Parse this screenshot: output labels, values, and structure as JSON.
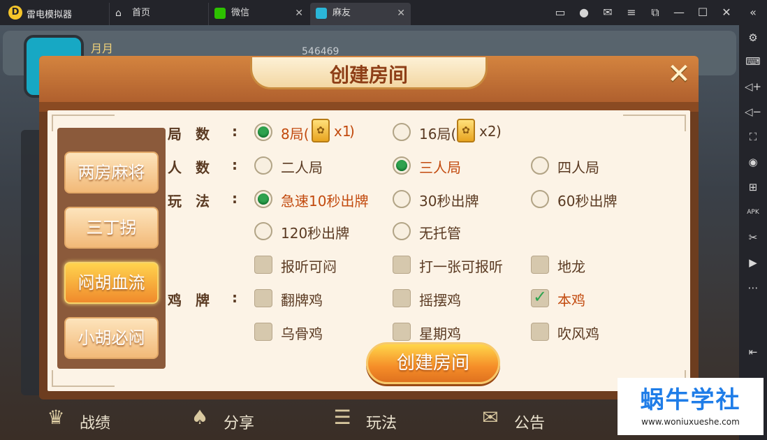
{
  "titlebar": {
    "app_name": "雷电模拟器",
    "tabs": [
      {
        "label": "首页",
        "icon": "home-icon"
      },
      {
        "label": "微信",
        "icon": "wechat-icon"
      },
      {
        "label": "麻友",
        "icon": "mayou-app-icon"
      }
    ]
  },
  "game_bg": {
    "player_name": "月月",
    "coins": "546469",
    "bottom_nav": [
      {
        "label": "战绩",
        "icon": "trophy-icon"
      },
      {
        "label": "分享",
        "icon": "share-icon"
      },
      {
        "label": "玩法",
        "icon": "rules-icon"
      },
      {
        "label": "公告",
        "icon": "mail-icon"
      }
    ]
  },
  "dialog": {
    "title": "创建房间",
    "modes": [
      "两房麻将",
      "三丁拐",
      "闷胡血流",
      "小胡必闷"
    ],
    "selected_mode": "闷胡血流",
    "labels": {
      "rounds": "局数",
      "players": "人数",
      "play": "玩法",
      "chicken": "鸡牌"
    },
    "rounds": [
      {
        "text": "8局(",
        "multiplier": "x1",
        "checked": true
      },
      {
        "text": "16局(",
        "multiplier": "x2",
        "checked": false
      }
    ],
    "players": [
      {
        "text": "二人局",
        "checked": false
      },
      {
        "text": "三人局",
        "checked": true
      },
      {
        "text": "四人局",
        "checked": false
      }
    ],
    "play": [
      {
        "text": "急速10秒出牌",
        "checked": true
      },
      {
        "text": "30秒出牌",
        "checked": false
      },
      {
        "text": "60秒出牌",
        "checked": false
      },
      {
        "text": "120秒出牌",
        "checked": false
      },
      {
        "text": "无托管",
        "checked": false
      }
    ],
    "extras": [
      {
        "text": "报听可闷",
        "checked": false
      },
      {
        "text": "打一张可报听",
        "checked": false
      },
      {
        "text": "地龙",
        "checked": false
      }
    ],
    "chicken": [
      {
        "text": "翻牌鸡",
        "checked": false
      },
      {
        "text": "摇摆鸡",
        "checked": false
      },
      {
        "text": "本鸡",
        "checked": true
      },
      {
        "text": "乌骨鸡",
        "checked": false
      },
      {
        "text": "星期鸡",
        "checked": false
      },
      {
        "text": "吹风鸡",
        "checked": false
      }
    ],
    "create_button": "创建房间"
  },
  "watermark": {
    "title": "蜗牛学社",
    "url": "www.woniuxueshe.com"
  },
  "colors": {
    "accent": "#c24a0e",
    "radio_on": "#2fa24e",
    "watermark": "#1f7de8"
  }
}
